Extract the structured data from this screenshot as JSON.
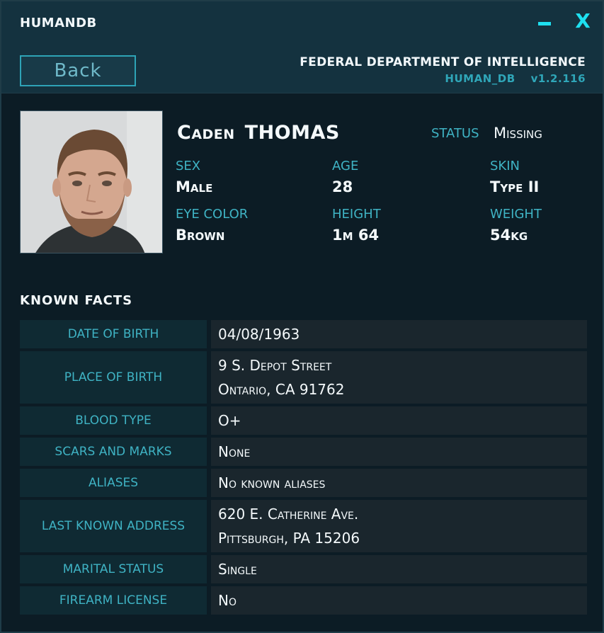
{
  "window": {
    "title": "HUMANDB",
    "minimize_glyph": "–",
    "close_glyph": "X"
  },
  "header": {
    "back_label": "Back",
    "agency": "FEDERAL DEPARTMENT OF INTELLIGENCE",
    "db_name": "HUMAN_DB",
    "version": "v1.2.116"
  },
  "profile": {
    "first_name": "Caden",
    "last_name": "THOMAS",
    "status_label": "STATUS",
    "status_value": "Missing",
    "attributes": [
      {
        "label": "SEX",
        "value": "Male"
      },
      {
        "label": "AGE",
        "value": "28"
      },
      {
        "label": "SKIN",
        "value": "Type II"
      },
      {
        "label": "EYE COLOR",
        "value": "Brown"
      },
      {
        "label": "HEIGHT",
        "value": "1m 64"
      },
      {
        "label": "WEIGHT",
        "value": "54kg"
      }
    ]
  },
  "facts": {
    "heading": "KNOWN FACTS",
    "rows": [
      {
        "label": "DATE OF BIRTH",
        "lines": [
          "04/08/1963"
        ]
      },
      {
        "label": "PLACE OF BIRTH",
        "lines": [
          "9 S. Depot Street",
          "Ontario, CA 91762"
        ]
      },
      {
        "label": "BLOOD TYPE",
        "lines": [
          "O+"
        ]
      },
      {
        "label": "SCARS AND MARKS",
        "lines": [
          "None"
        ]
      },
      {
        "label": "ALIASES",
        "lines": [
          "No known aliases"
        ]
      },
      {
        "label": "LAST KNOWN ADDRESS",
        "lines": [
          "620 E. Catherine Ave.",
          "Pittsburgh, PA 15206"
        ]
      },
      {
        "label": "MARITAL STATUS",
        "lines": [
          "Single"
        ]
      },
      {
        "label": "FIREARM LICENSE",
        "lines": [
          "No"
        ]
      }
    ]
  },
  "colors": {
    "accent": "#1ee0f0",
    "label": "#3fb3c4",
    "panel": "#0c1c25"
  }
}
